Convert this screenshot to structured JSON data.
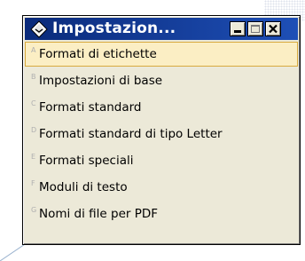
{
  "window": {
    "title": "Impostazion...",
    "buttons": {
      "minimize": "minimize",
      "maximize": "maximize",
      "close": "close"
    }
  },
  "menu": {
    "items": [
      {
        "key": "A",
        "label": "Formati di etichette",
        "selected": true
      },
      {
        "key": "B",
        "label": "Impostazioni di base"
      },
      {
        "key": "C",
        "label": "Formati standard"
      },
      {
        "key": "D",
        "label": "Formati standard di tipo Letter"
      },
      {
        "key": "E",
        "label": "Formati speciali"
      },
      {
        "key": "F",
        "label": "Moduli di testo"
      },
      {
        "key": "G",
        "label": "Nomi di file per PDF"
      }
    ]
  },
  "colors": {
    "titlebar": "#1e4fb6",
    "selection_fill": "#fbeec4",
    "selection_border": "#d8a93e",
    "window_bg": "#ece9d8"
  },
  "icons": {
    "app": "diamond-app-icon"
  }
}
